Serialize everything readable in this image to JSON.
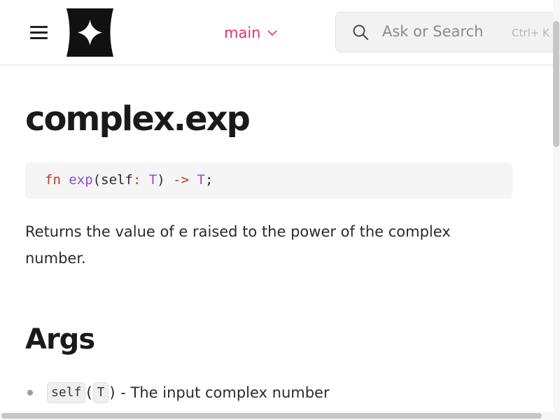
{
  "header": {
    "menu_icon": "hamburger-menu-icon",
    "logo_icon": "four-point-star-logo-icon",
    "branch": {
      "label": "main",
      "color": "#e0336c"
    },
    "search": {
      "placeholder": "Ask or Search",
      "shortcut": "Ctrl+ K",
      "icon": "search-icon"
    }
  },
  "page": {
    "title": "complex.exp",
    "signature": {
      "kw": "fn",
      "name": "exp",
      "open": "(",
      "param": "self",
      "colon": ":",
      "param_type": "T",
      "close": ")",
      "arrow": "->",
      "ret_type": "T",
      "semi": ";"
    },
    "description": "Returns the value of e raised to the power of the complex number.",
    "args_heading": "Args",
    "args": [
      {
        "name": "self",
        "open": "(",
        "type": "T",
        "close": ")",
        "desc": "- The input complex number"
      }
    ]
  },
  "colors": {
    "accent": "#e0336c",
    "keyword": "#c0392b",
    "function": "#8b4fd1"
  }
}
